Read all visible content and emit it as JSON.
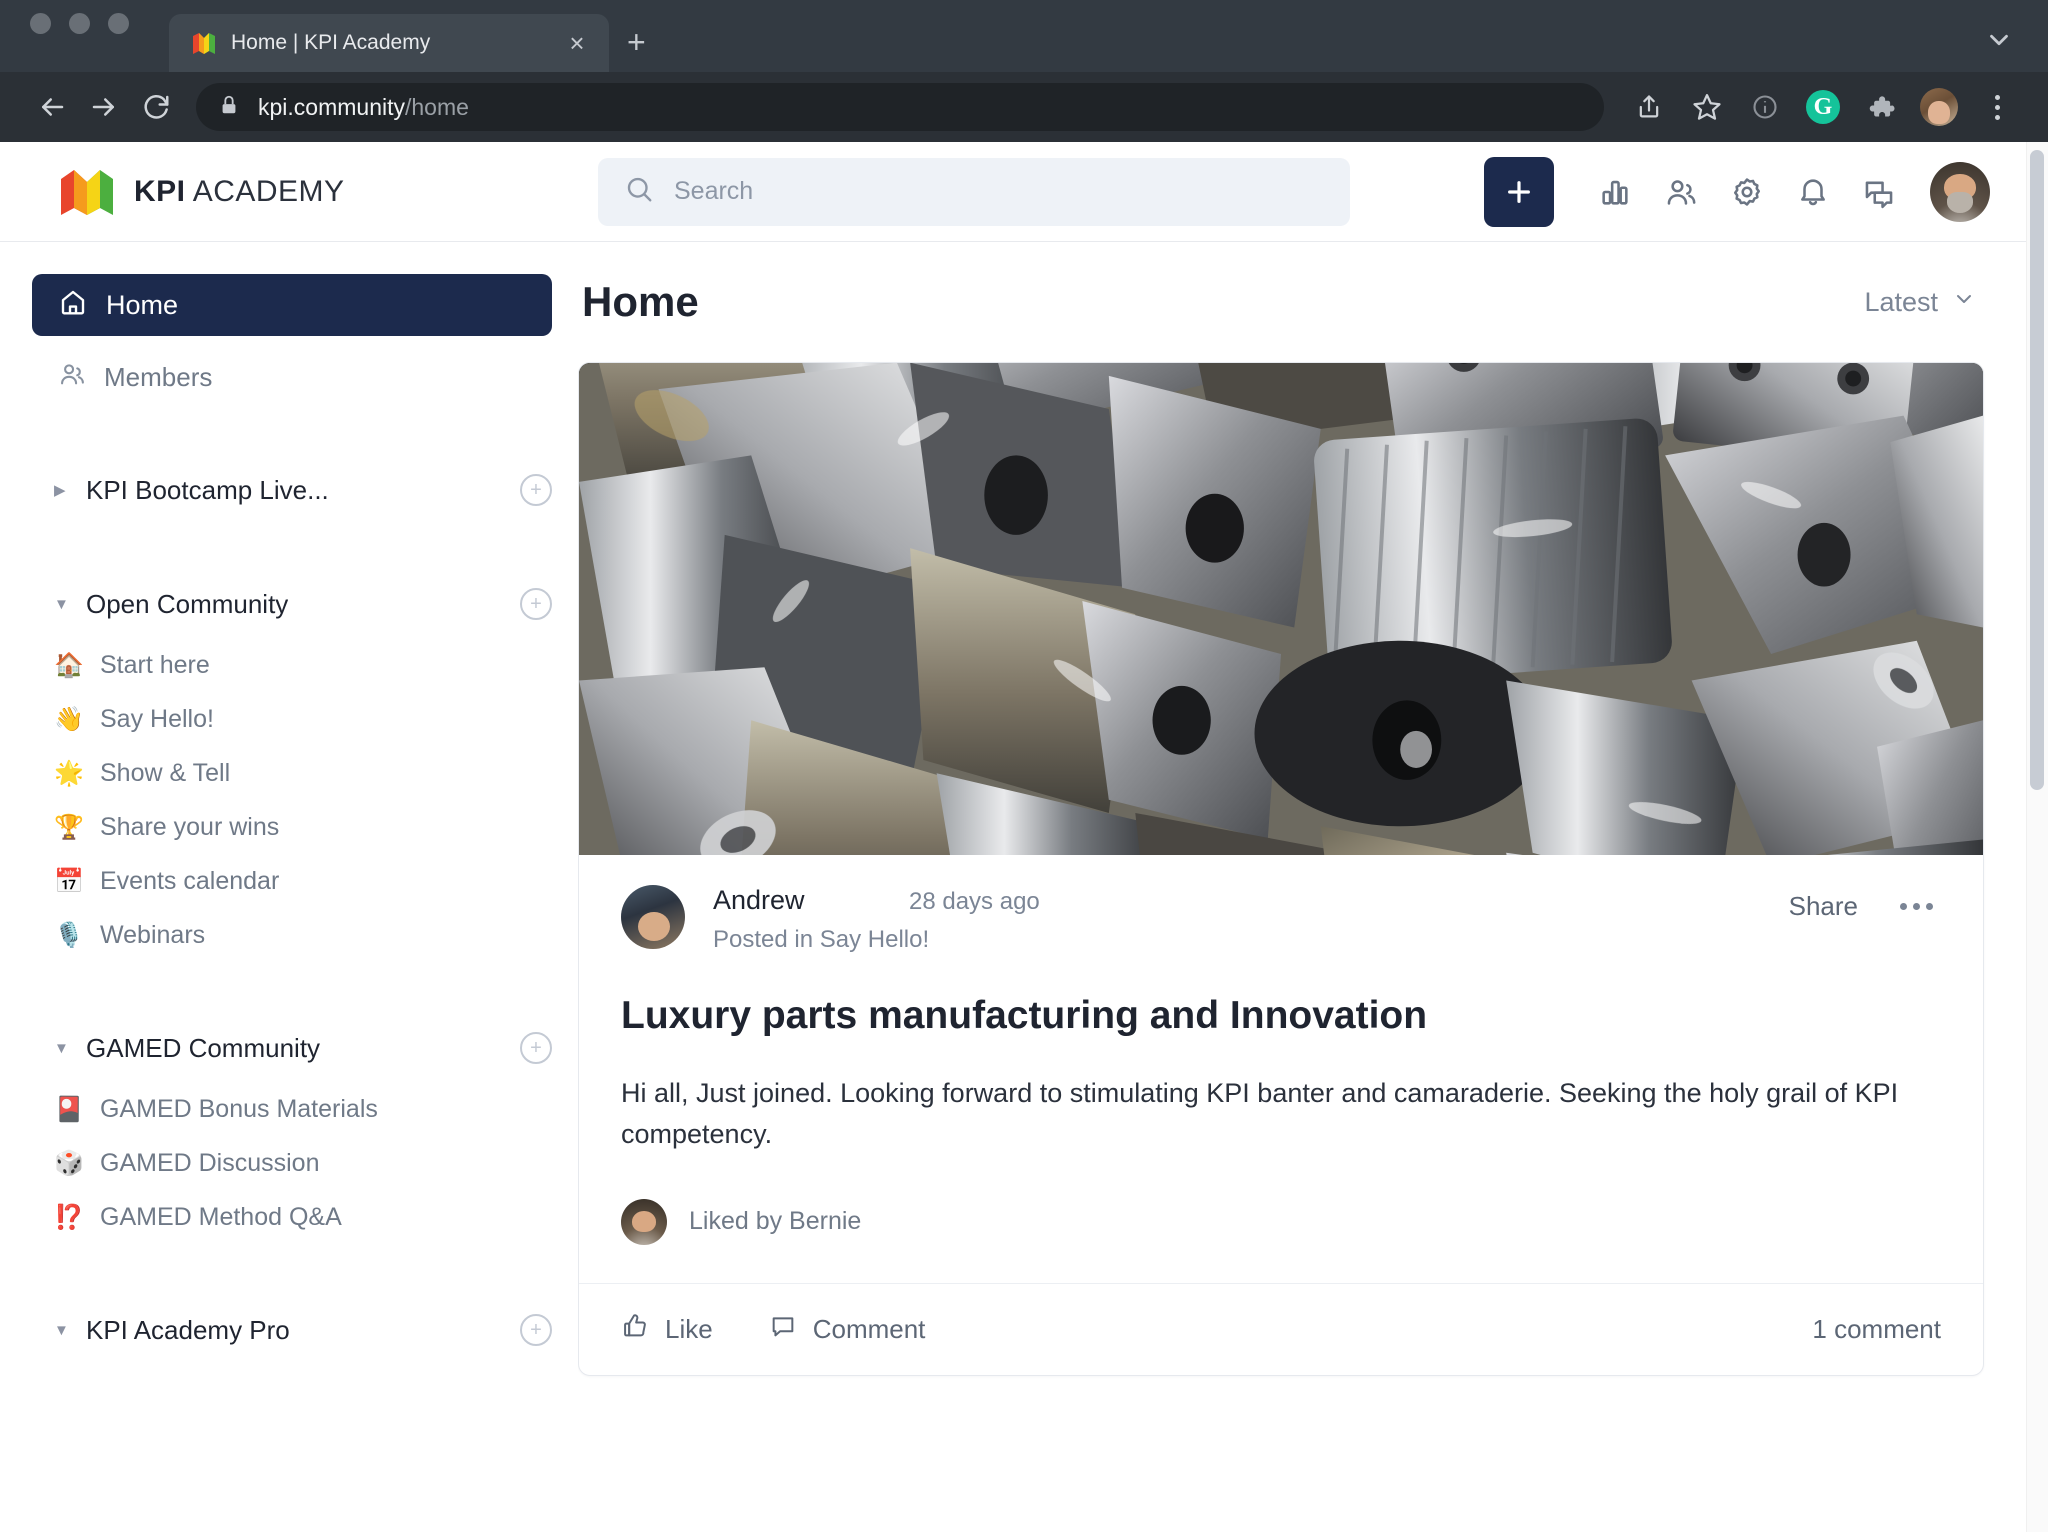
{
  "browser": {
    "tab": {
      "title": "Home | KPI Academy",
      "favicon": "kpi-book-favicon",
      "close_label": "×"
    },
    "new_tab_label": "+",
    "url_host": "kpi.community",
    "url_path": "/home",
    "toolbar_icons": [
      "share-icon",
      "bookmark-star-icon",
      "info-circle-icon",
      "grammarly-icon",
      "extensions-puzzle-icon",
      "browser-profile-avatar",
      "browser-menu-kebab"
    ],
    "grammarly_letter": "G"
  },
  "header": {
    "logo_bold": "KPI",
    "logo_light": " ACADEMY",
    "search": {
      "placeholder": "Search",
      "value": ""
    },
    "create_label": "+",
    "icons": [
      "analytics-icon",
      "members-icon",
      "settings-gear-icon",
      "notifications-bell-icon",
      "messages-chat-icon"
    ],
    "accent_navy": "#1c2a4d",
    "search_bg": "#eef2f7"
  },
  "sidebar": {
    "home_label": "Home",
    "members_label": "Members",
    "sections": [
      {
        "title": "KPI Bootcamp Live...",
        "expanded": false,
        "caret": "▶",
        "add_label": "+",
        "items": []
      },
      {
        "title": "Open Community",
        "expanded": true,
        "caret": "▼",
        "add_label": "+",
        "items": [
          {
            "emoji": "🏠",
            "label": "Start here"
          },
          {
            "emoji": "👋",
            "label": "Say Hello!"
          },
          {
            "emoji": "🌟",
            "label": "Show & Tell"
          },
          {
            "emoji": "🏆",
            "label": "Share your wins"
          },
          {
            "emoji": "📅",
            "label": "Events calendar"
          },
          {
            "emoji": "🎙️",
            "label": "Webinars"
          }
        ]
      },
      {
        "title": "GAMED Community",
        "expanded": true,
        "caret": "▼",
        "add_label": "+",
        "items": [
          {
            "emoji": "🎴",
            "label": "GAMED Bonus Materials"
          },
          {
            "emoji": "🎲",
            "label": "GAMED Discussion"
          },
          {
            "emoji": "⁉️",
            "label": "GAMED Method Q&A"
          }
        ]
      },
      {
        "title": "KPI Academy Pro",
        "expanded": true,
        "caret": "▼",
        "add_label": "+",
        "items": []
      }
    ]
  },
  "main": {
    "page_title": "Home",
    "sort_label": "Latest",
    "post": {
      "hero_alt": "pile of shiny machined metal parts",
      "author": "Andrew",
      "time": "28 days ago",
      "posted_in": "Posted in Say Hello!",
      "share_label": "Share",
      "title": "Luxury parts manufacturing and Innovation",
      "body": "Hi all, Just joined. Looking forward to stimulating KPI banter and camaraderie. Seeking the holy grail of KPI competency.",
      "liked_by": "Liked by Bernie",
      "like_label": "Like",
      "comment_label": "Comment",
      "comment_count": "1 comment"
    }
  }
}
